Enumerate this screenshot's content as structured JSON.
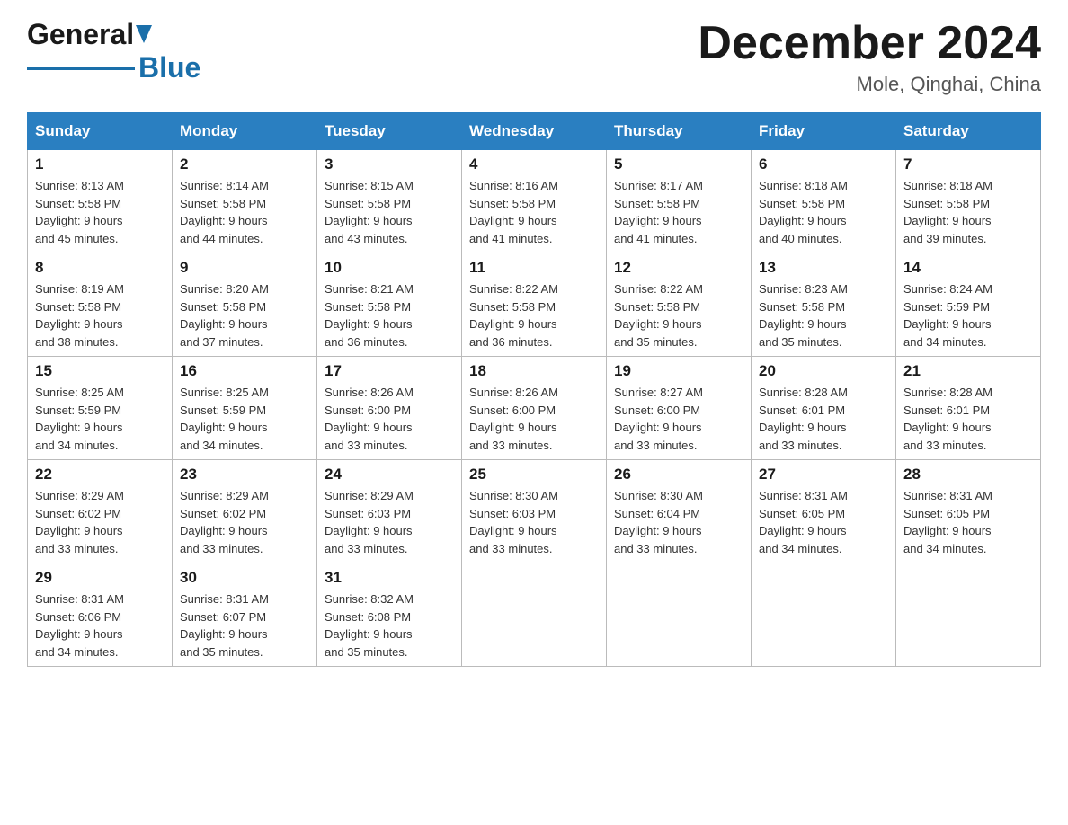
{
  "header": {
    "month_title": "December 2024",
    "location": "Mole, Qinghai, China",
    "logo_general": "General",
    "logo_blue": "Blue"
  },
  "days_of_week": [
    "Sunday",
    "Monday",
    "Tuesday",
    "Wednesday",
    "Thursday",
    "Friday",
    "Saturday"
  ],
  "weeks": [
    [
      {
        "day": "1",
        "sunrise": "8:13 AM",
        "sunset": "5:58 PM",
        "daylight": "9 hours and 45 minutes."
      },
      {
        "day": "2",
        "sunrise": "8:14 AM",
        "sunset": "5:58 PM",
        "daylight": "9 hours and 44 minutes."
      },
      {
        "day": "3",
        "sunrise": "8:15 AM",
        "sunset": "5:58 PM",
        "daylight": "9 hours and 43 minutes."
      },
      {
        "day": "4",
        "sunrise": "8:16 AM",
        "sunset": "5:58 PM",
        "daylight": "9 hours and 41 minutes."
      },
      {
        "day": "5",
        "sunrise": "8:17 AM",
        "sunset": "5:58 PM",
        "daylight": "9 hours and 41 minutes."
      },
      {
        "day": "6",
        "sunrise": "8:18 AM",
        "sunset": "5:58 PM",
        "daylight": "9 hours and 40 minutes."
      },
      {
        "day": "7",
        "sunrise": "8:18 AM",
        "sunset": "5:58 PM",
        "daylight": "9 hours and 39 minutes."
      }
    ],
    [
      {
        "day": "8",
        "sunrise": "8:19 AM",
        "sunset": "5:58 PM",
        "daylight": "9 hours and 38 minutes."
      },
      {
        "day": "9",
        "sunrise": "8:20 AM",
        "sunset": "5:58 PM",
        "daylight": "9 hours and 37 minutes."
      },
      {
        "day": "10",
        "sunrise": "8:21 AM",
        "sunset": "5:58 PM",
        "daylight": "9 hours and 36 minutes."
      },
      {
        "day": "11",
        "sunrise": "8:22 AM",
        "sunset": "5:58 PM",
        "daylight": "9 hours and 36 minutes."
      },
      {
        "day": "12",
        "sunrise": "8:22 AM",
        "sunset": "5:58 PM",
        "daylight": "9 hours and 35 minutes."
      },
      {
        "day": "13",
        "sunrise": "8:23 AM",
        "sunset": "5:58 PM",
        "daylight": "9 hours and 35 minutes."
      },
      {
        "day": "14",
        "sunrise": "8:24 AM",
        "sunset": "5:59 PM",
        "daylight": "9 hours and 34 minutes."
      }
    ],
    [
      {
        "day": "15",
        "sunrise": "8:25 AM",
        "sunset": "5:59 PM",
        "daylight": "9 hours and 34 minutes."
      },
      {
        "day": "16",
        "sunrise": "8:25 AM",
        "sunset": "5:59 PM",
        "daylight": "9 hours and 34 minutes."
      },
      {
        "day": "17",
        "sunrise": "8:26 AM",
        "sunset": "6:00 PM",
        "daylight": "9 hours and 33 minutes."
      },
      {
        "day": "18",
        "sunrise": "8:26 AM",
        "sunset": "6:00 PM",
        "daylight": "9 hours and 33 minutes."
      },
      {
        "day": "19",
        "sunrise": "8:27 AM",
        "sunset": "6:00 PM",
        "daylight": "9 hours and 33 minutes."
      },
      {
        "day": "20",
        "sunrise": "8:28 AM",
        "sunset": "6:01 PM",
        "daylight": "9 hours and 33 minutes."
      },
      {
        "day": "21",
        "sunrise": "8:28 AM",
        "sunset": "6:01 PM",
        "daylight": "9 hours and 33 minutes."
      }
    ],
    [
      {
        "day": "22",
        "sunrise": "8:29 AM",
        "sunset": "6:02 PM",
        "daylight": "9 hours and 33 minutes."
      },
      {
        "day": "23",
        "sunrise": "8:29 AM",
        "sunset": "6:02 PM",
        "daylight": "9 hours and 33 minutes."
      },
      {
        "day": "24",
        "sunrise": "8:29 AM",
        "sunset": "6:03 PM",
        "daylight": "9 hours and 33 minutes."
      },
      {
        "day": "25",
        "sunrise": "8:30 AM",
        "sunset": "6:03 PM",
        "daylight": "9 hours and 33 minutes."
      },
      {
        "day": "26",
        "sunrise": "8:30 AM",
        "sunset": "6:04 PM",
        "daylight": "9 hours and 33 minutes."
      },
      {
        "day": "27",
        "sunrise": "8:31 AM",
        "sunset": "6:05 PM",
        "daylight": "9 hours and 34 minutes."
      },
      {
        "day": "28",
        "sunrise": "8:31 AM",
        "sunset": "6:05 PM",
        "daylight": "9 hours and 34 minutes."
      }
    ],
    [
      {
        "day": "29",
        "sunrise": "8:31 AM",
        "sunset": "6:06 PM",
        "daylight": "9 hours and 34 minutes."
      },
      {
        "day": "30",
        "sunrise": "8:31 AM",
        "sunset": "6:07 PM",
        "daylight": "9 hours and 35 minutes."
      },
      {
        "day": "31",
        "sunrise": "8:32 AM",
        "sunset": "6:08 PM",
        "daylight": "9 hours and 35 minutes."
      },
      null,
      null,
      null,
      null
    ]
  ],
  "labels": {
    "sunrise": "Sunrise:",
    "sunset": "Sunset:",
    "daylight": "Daylight:"
  }
}
